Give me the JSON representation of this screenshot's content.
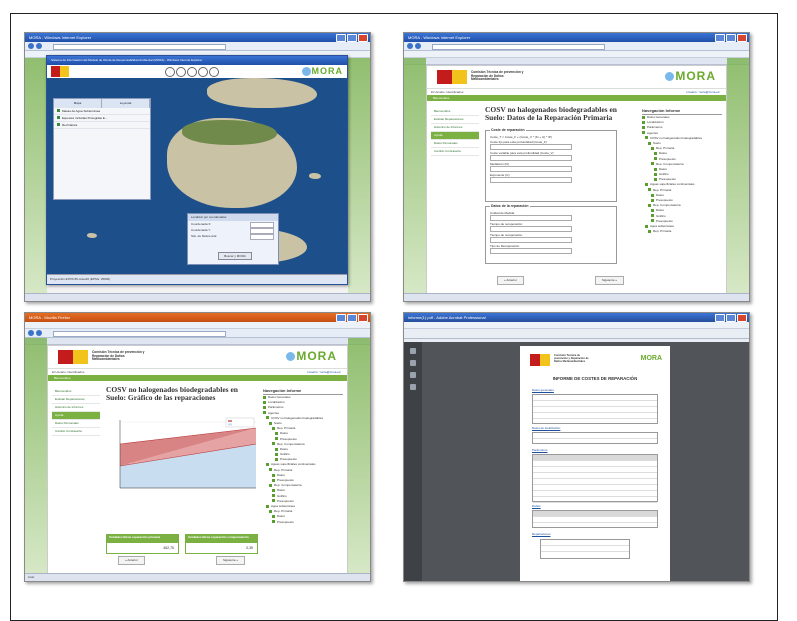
{
  "figure": {
    "panels": [
      {
        "id": "map",
        "window_title": "MORA - Windows Internet Explorer",
        "app_title": "Sistema de Información del Modelo de Oferta de Responsabilidad Ambiental (MORA) - Windows Internet Explorer",
        "logo_text": "MORA",
        "layers_tabs": [
          "Mapa",
          "Leyenda"
        ],
        "layers": [
          "Masas de Agua Subterránea",
          "Especies Incluidas Protegidas E...",
          "Red Natura"
        ],
        "coord_box_title": "Localizar por coordenadas",
        "coord_labels": [
          "Coordenada X:",
          "Coordenada Y:",
          "Sist. de Referencia:"
        ],
        "coord_button": "Buscar y MORA",
        "footer": "Proyección ETRS 89 Huso30 (EPSG: 25830)"
      },
      {
        "id": "form",
        "window_title": "MORA - Windows Internet Explorer",
        "logo_text": "MORA",
        "ministry": "Comisión Técnica de prevención y Reparación de Daños Medioambientales",
        "breadcrumb": "El Usuario: Identificados",
        "user": "Usuario: 'mora@mma.es'",
        "greenbar": "Bienvenidos",
        "left_nav": [
          "Bienvenidos",
          "Evaluar Reparaciones",
          "Historico de Informes",
          "Ayuda",
          "Datos Personales",
          "Cambio Contraseña"
        ],
        "content_title": "COSV no halogenados biodegradables en Suelo: Datos de la Reparación Primaria",
        "fieldset1": "Coste de reparación",
        "formula": "Coste_T = Coste_F + (Coste_V * (Ki + Ic) * IP)",
        "fields1": [
          "Coste fijo para esta profundidad (Coste_F)",
          "Coste variable para esta profundidad (Coste_V)",
          "Mediación (Ki)",
          "Exponente (Ic)"
        ],
        "fieldset2": "Datos de la reparación",
        "fields2": [
          "Unidad de Medida",
          "Tiempo de recuperación",
          "Tiempo de recuperación",
          "Tipo de Recuperación"
        ],
        "prev": "« Anterior",
        "next": "Siguiente »",
        "tree_title": "Navegación Informe",
        "tree": [
          "Datos Generales",
          "Localización",
          "Parámetros",
          "Agentes",
          "COSV no halogenados biodegradables",
          "Suelo",
          "Rep. Primaria",
          "Datos",
          "Presupuesto",
          "Rep. Compensatoria",
          "Datos",
          "Gráfico",
          "Presupuesto",
          "Aguas superficiales continentales",
          "Rep. Primaria",
          "Datos",
          "Presupuesto",
          "Rep. Compensatoria",
          "Datos",
          "Gráfico",
          "Presupuesto",
          "Agua subterránea",
          "Rep. Primaria"
        ]
      },
      {
        "id": "chart",
        "window_title": "MORA - Mozilla Firefox",
        "logo_text": "MORA",
        "ministry": "Comisión Técnica de prevención y Reparación de Daños Medioambientales",
        "breadcrumb": "El Usuario: Identificados",
        "user": "Usuario: 'mora@mma.es'",
        "greenbar": "Bienvenidos",
        "left_nav": [
          "Bienvenidos",
          "Evaluar Reparaciones",
          "Historico de Informes",
          "Ayuda",
          "Datos Personales",
          "Cambio Contraseña"
        ],
        "content_title": "COSV no halogenados biodegradables en Suelo: Gráfico de las reparaciones",
        "results": [
          {
            "label": "Unidades Bicas reparación primaria",
            "value": "462,75"
          },
          {
            "label": "Unidades Bicas reparación compensatoria",
            "value": "0,35"
          }
        ],
        "prev": "« Anterior",
        "next": "Siguiente »",
        "tree_title": "Navegación Informe",
        "tree": [
          "Datos Generales",
          "Localización",
          "Parámetros",
          "Agentes",
          "COSV no halogenados biodegradables",
          "Suelo",
          "Rep. Primaria",
          "Datos",
          "Presupuesto",
          "Rep. Compensatoria",
          "Datos",
          "Gráfico",
          "Presupuesto",
          "Aguas superficiales continentales",
          "Rep. Primaria",
          "Datos",
          "Presupuesto",
          "Rep. Compensatoria",
          "Datos",
          "Gráfico",
          "Presupuesto",
          "Agua subterránea",
          "Rep. Primaria",
          "Datos",
          "Presupuesto"
        ],
        "status": "Listo"
      },
      {
        "id": "pdf",
        "window_title": "informe(1).pdf - Adobe Acrobat Professional",
        "logo_text": "MORA",
        "ministry": "Comisión Técnica de prevención y Reparación de Daños Medioambientales",
        "report_title": "INFORME DE COSTES DE REPARACIÓN",
        "sections": [
          "Datos generales",
          "Datos de localización",
          "Parámetros",
          "Daños",
          "Reparaciones"
        ]
      }
    ]
  },
  "colors": {
    "ie_title": "#1f4fa8",
    "firefox_title": "#c54f12",
    "mora_green": "#7bb043",
    "sea": "#1d4f8a"
  }
}
